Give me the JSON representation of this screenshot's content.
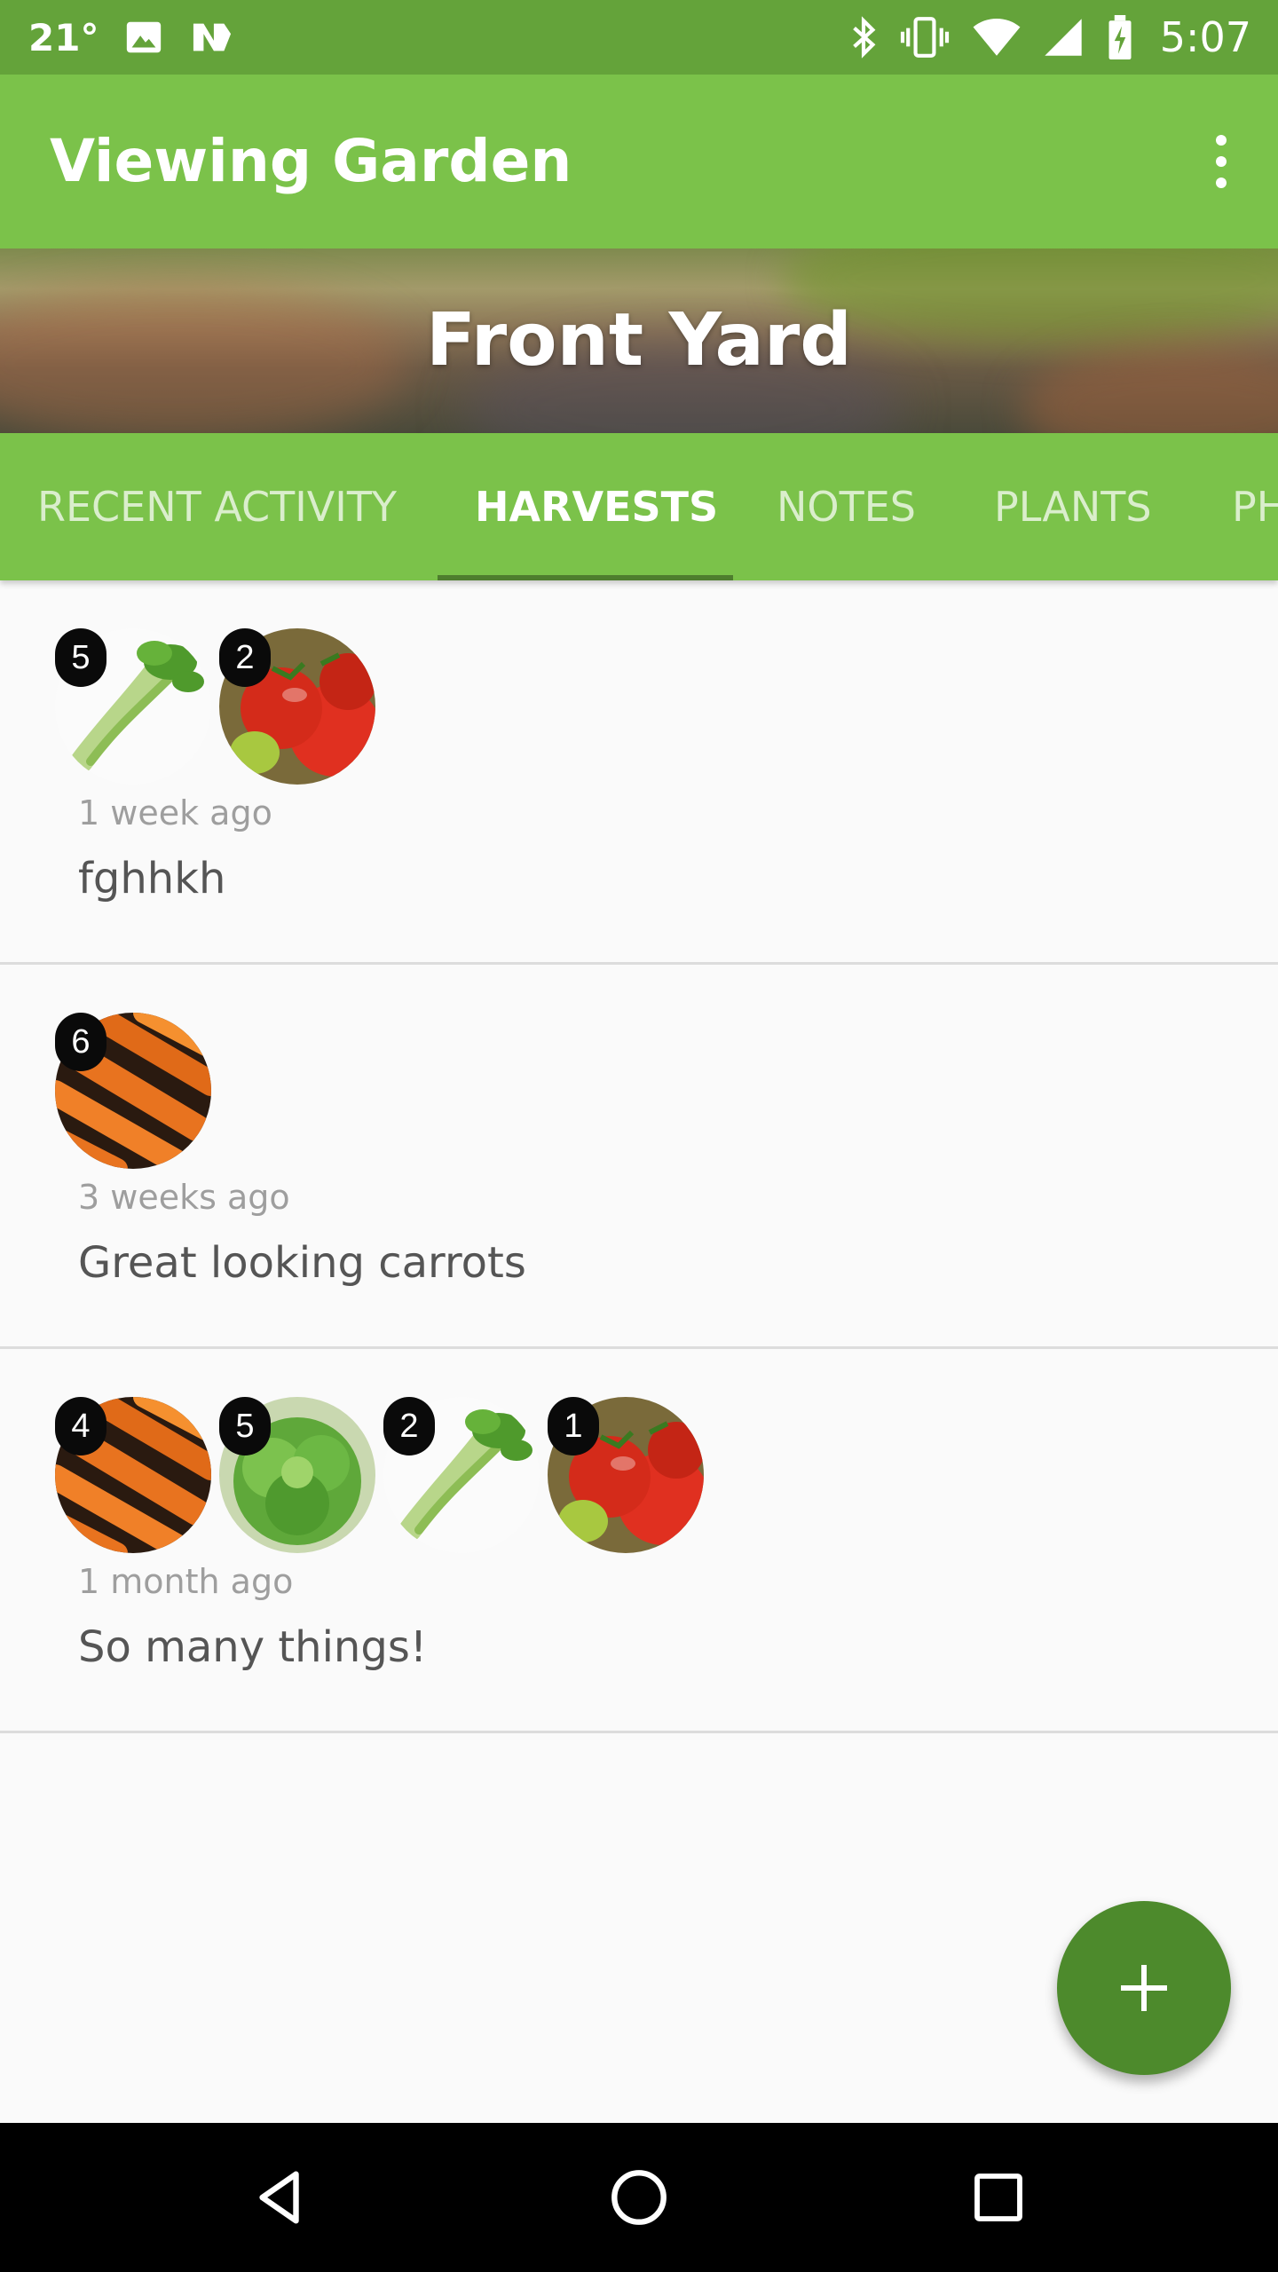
{
  "status_bar": {
    "temperature": "21°",
    "time": "5:07",
    "icons": [
      "image-icon",
      "news-icon",
      "bluetooth-icon",
      "vibrate-icon",
      "wifi-icon",
      "cell-signal-icon",
      "battery-charging-icon"
    ]
  },
  "app_bar": {
    "title": "Viewing Garden",
    "overflow_icon": "more-vert-icon"
  },
  "header": {
    "garden_name": "Front Yard"
  },
  "tabs": [
    {
      "label": "RECENT ACTIVITY",
      "active": false
    },
    {
      "label": "HARVESTS",
      "active": true
    },
    {
      "label": "NOTES",
      "active": false
    },
    {
      "label": "PLANTS",
      "active": false
    },
    {
      "label": "PH",
      "active": false
    }
  ],
  "harvests": [
    {
      "items": [
        {
          "plant": "celery",
          "count": "5"
        },
        {
          "plant": "tomato",
          "count": "2"
        }
      ],
      "time_ago": "1 week ago",
      "note": "fghhkh"
    },
    {
      "items": [
        {
          "plant": "carrot",
          "count": "6"
        }
      ],
      "time_ago": "3 weeks ago",
      "note": "Great looking carrots"
    },
    {
      "items": [
        {
          "plant": "carrot",
          "count": "4"
        },
        {
          "plant": "lettuce",
          "count": "5"
        },
        {
          "plant": "celery",
          "count": "2"
        },
        {
          "plant": "tomato",
          "count": "1"
        }
      ],
      "time_ago": "1 month ago",
      "note": "So many things!"
    }
  ],
  "fab": {
    "icon": "add-icon"
  },
  "nav_bar": {
    "icons": [
      "back-icon",
      "home-icon",
      "recents-icon"
    ]
  },
  "colors": {
    "status_bar": "#64a33a",
    "primary": "#7bc24a",
    "accent": "#4d8a2c",
    "tab_indicator": "#4e7d2e"
  }
}
